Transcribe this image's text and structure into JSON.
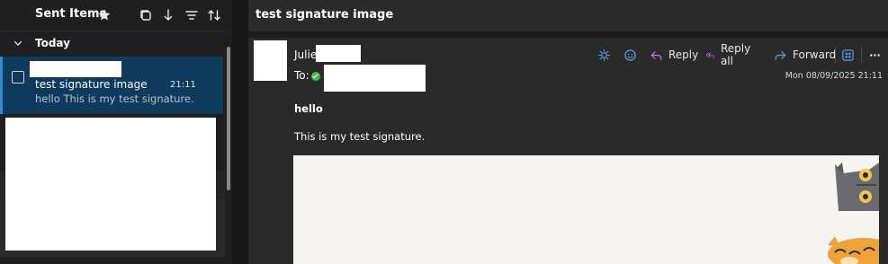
{
  "folder": {
    "title": "Sent Items",
    "group_label": "Today"
  },
  "message_list": {
    "items": [
      {
        "subject": "test signature image",
        "time": "21:11",
        "preview": "hello This is my test signature."
      }
    ]
  },
  "reading_pane": {
    "subject": "test signature image",
    "sender_name": "Julie",
    "to_label": "To:",
    "date": "Mon 08/09/2025 21:11",
    "actions": {
      "reply": "Reply",
      "reply_all": "Reply all",
      "forward": "Forward"
    },
    "body": {
      "line1": "hello",
      "line2": "This is my test signature."
    }
  },
  "colors": {
    "selected_item": "#0e3a5c",
    "accent": "#2f8ad6",
    "reply_all_icon": "#b259d0",
    "forward_icon": "#5aa0e6",
    "reply_icon": "#c77bd8",
    "status_green": "#46b450"
  }
}
